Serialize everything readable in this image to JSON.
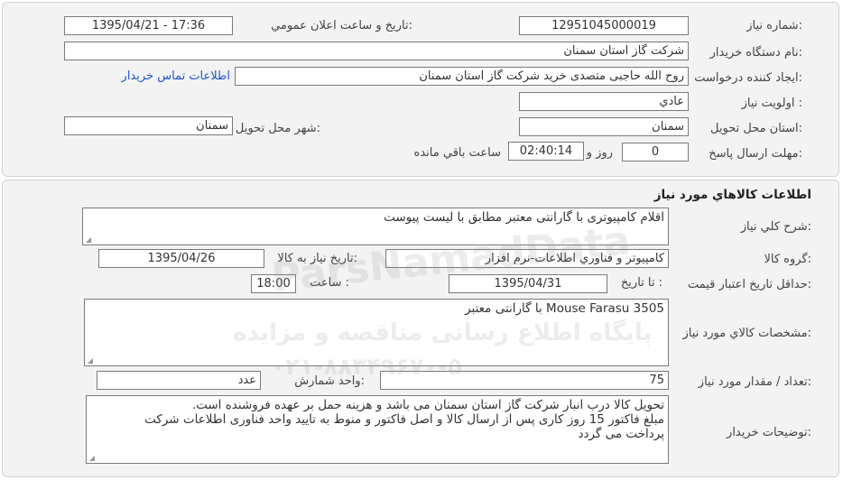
{
  "need_info": {
    "need_number_label": "شماره نياز:",
    "need_number": "12951045000019",
    "announce_label": "تاريخ و ساعت اعلان عمومي:",
    "announce_value": "1395/04/21 - 17:36",
    "buyer_org_label": "نام دستگاه خريدار:",
    "buyer_org": "شركت گاز استان سمنان",
    "creator_label": "ايجاد كننده درخواست:",
    "creator": "روح الله  حاجبی متصدی خرید شرکت گاز استان سمنان",
    "contact_link": "اطلاعات تماس خريدار",
    "priority_label": "اولويت نياز :",
    "priority": "عادي",
    "province_label": "استان محل تحويل:",
    "province": "سمنان",
    "city_label": "شهر محل تحويل:",
    "city": "سمنان",
    "deadline_label": "مهلت ارسال پاسخ:",
    "days": "0",
    "days_unit": "روز و",
    "time_left": "02:40:14",
    "time_left_label": "ساعت باقي مانده"
  },
  "goods": {
    "section_title": "اطلاعات كالاهاي مورد نياز",
    "general_desc_label": "شرح كلي نياز:",
    "general_desc": "اقلام کامپیوتری با گارانتی معتبر مطابق با لیست پیوست",
    "group_label": "گروه كالا:",
    "group": "كامپيوتر و فناوري اطلاعات-نرم افزار",
    "need_date_label": "تاريخ نياز به كالا:",
    "need_date": "1395/04/26",
    "validity_label": "حداقل تاريخ اعتبار قيمت:",
    "to_date_label": "تا تاريخ :",
    "to_date": "1395/04/31",
    "time_label": "ساعت :",
    "time": "18:00",
    "specs_label": "مشخصات كالاي مورد نياز:",
    "specs": "Mouse Farasu 3505 با گارانتی معتبر",
    "qty_label": "تعداد / مقدار مورد نياز:",
    "qty": "75",
    "unit_label": "واحد شمارش:",
    "unit": "عدد",
    "buyer_notes_label": "توضيحات خريدار:",
    "buyer_notes": [
      "تحویل کالا درب انبار شرکت گاز استان سمنان می باشد و هزینه حمل بر عهده فروشنده است.",
      "مبلغ فاکتور 15 روز کاری پس از ارسال کالا و اصل فاکتور و منوط به تایید واحد فناوری اطلاعات شرکت",
      "پرداخت می گردد"
    ]
  },
  "watermark": {
    "brand": "ParsNamadData",
    "line1": "پایگاه اطلاع رسانی مناقصه و مزایده",
    "line2": "۰۲۱-۸۸۳۴۹۶۷۰-۵"
  }
}
